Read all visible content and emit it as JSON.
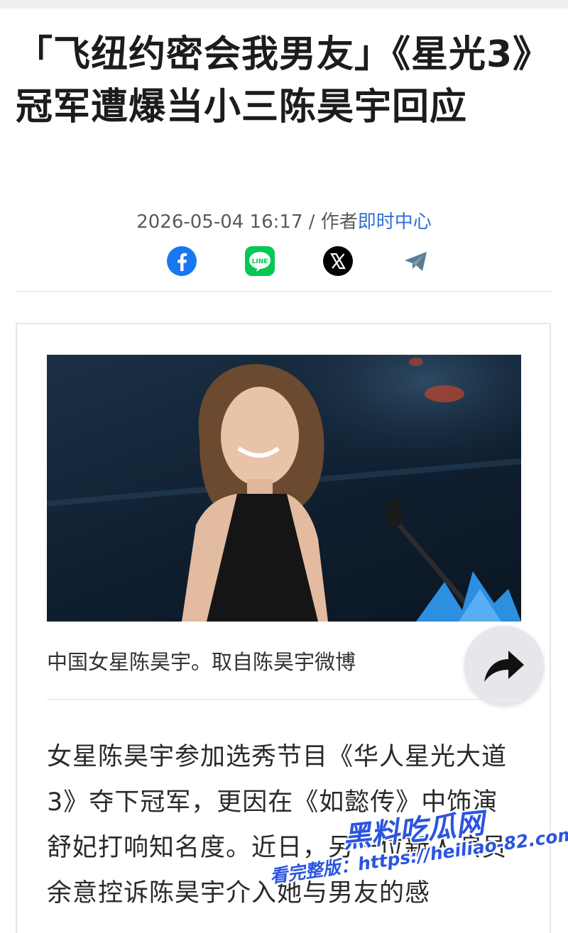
{
  "article": {
    "title": "「飞纽约密会我男友」《星光3》冠军遭爆当小三陈昊宇回应",
    "date": "2026-05-04 16:17",
    "separator": " / ",
    "author_prefix": "作者",
    "author": "即时中心"
  },
  "share_icons": [
    "facebook-icon",
    "line-icon",
    "x-icon",
    "telegram-icon"
  ],
  "line_label": "LINE",
  "image": {
    "caption": "中国女星陈昊宇。取自陈昊宇微博"
  },
  "body": "女星陈昊宇参加选秀节目《华人星光大道3》夺下冠军，更因在《如懿传》中饰演舒妃打响知名度。近日，另一位新人演员余意控诉陈昊宇介入她与男友的感",
  "watermark": {
    "brand": "黑料吃瓜网",
    "url_line": "看完整版：https://heiliao-82.com"
  },
  "colors": {
    "facebook": "#1877f2",
    "line": "#06c755",
    "x": "#000000",
    "telegram": "#5a7d93",
    "author_link": "#2f6fd6"
  }
}
